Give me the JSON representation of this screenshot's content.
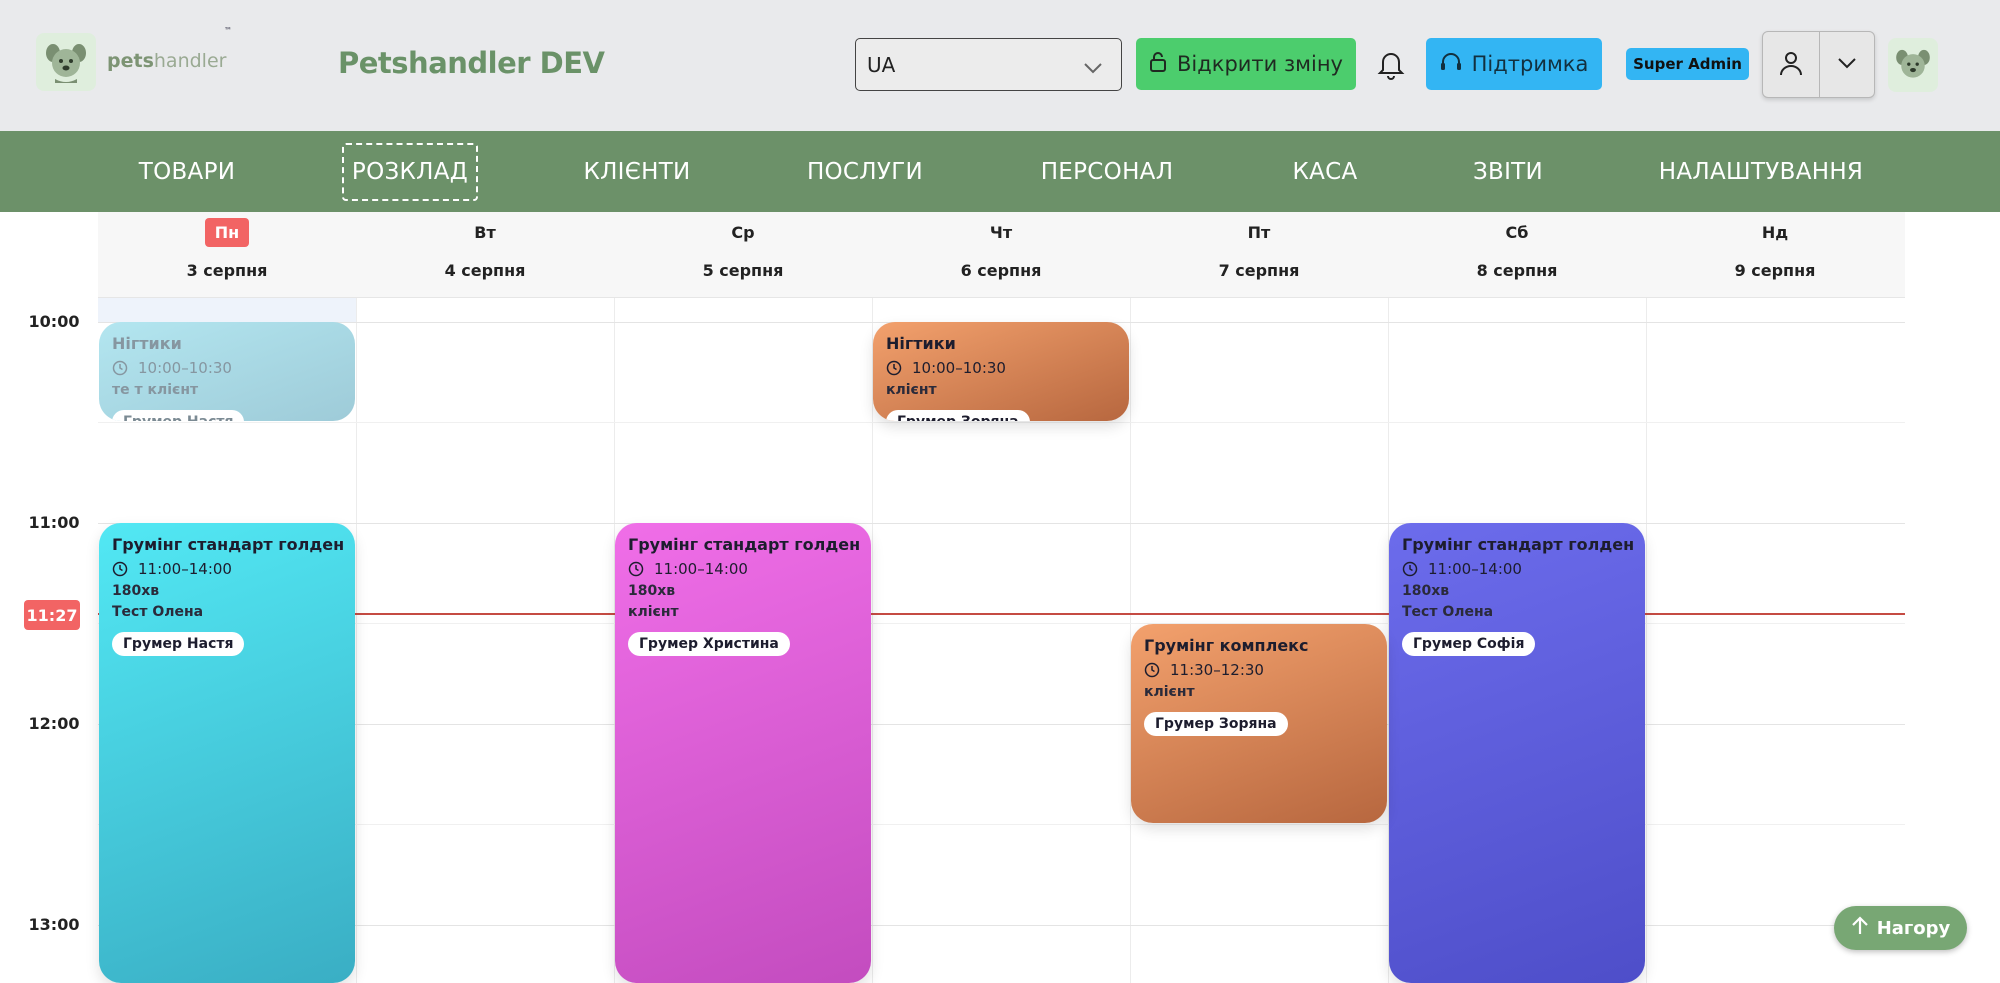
{
  "header": {
    "logo_text_bold": "pets",
    "logo_text_light": "handler",
    "logo_tm": "™",
    "app_title": "Petshandler DEV",
    "language": "UA",
    "open_shift_label": "Відкрити зміну",
    "support_label": "Підтримка",
    "role_badge": "Super Admin"
  },
  "nav": {
    "items": [
      "ТОВАРИ",
      "РОЗКЛАД",
      "КЛІЄНТИ",
      "ПОСЛУГИ",
      "ПЕРСОНАЛ",
      "КАСА",
      "ЗВІТИ",
      "НАЛАШТУВАННЯ"
    ],
    "active": "РОЗКЛАД"
  },
  "calendar": {
    "days": [
      {
        "name": "Пн",
        "date": "3 серпня",
        "today": true
      },
      {
        "name": "Вт",
        "date": "4 серпня",
        "today": false
      },
      {
        "name": "Ср",
        "date": "5 серпня",
        "today": false
      },
      {
        "name": "Чт",
        "date": "6 серпня",
        "today": false
      },
      {
        "name": "Пт",
        "date": "7 серпня",
        "today": false
      },
      {
        "name": "Сб",
        "date": "8 серпня",
        "today": false
      },
      {
        "name": "Нд",
        "date": "9 серпня",
        "today": false
      }
    ],
    "hours": [
      "10:00",
      "11:00",
      "12:00",
      "13:00"
    ],
    "now_label": "11:27",
    "events": [
      {
        "day": 0,
        "start": "10:00",
        "end": "10:30",
        "title": "Нігтики",
        "time": "10:00–10:30",
        "lines": [
          "те т клієнт"
        ],
        "groomer": "Грумер Настя",
        "past": true,
        "gradient": [
          "#b3e6f0",
          "#9ecbd8"
        ]
      },
      {
        "day": 3,
        "start": "10:00",
        "end": "10:30",
        "title": "Нігтики",
        "time": "10:00–10:30",
        "lines": [
          "клієнт"
        ],
        "groomer": "Грумер Зоряна",
        "past": false,
        "gradient": [
          "#f3a16d",
          "#b7673f"
        ]
      },
      {
        "day": 0,
        "start": "11:00",
        "end": "14:00",
        "title": "Грумінг стандарт голден",
        "time": "11:00–14:00",
        "lines": [
          "180хв",
          "Тест Олена"
        ],
        "groomer": "Грумер Настя",
        "past": false,
        "gradient": [
          "#52e8f4",
          "#3aaec4"
        ]
      },
      {
        "day": 2,
        "start": "11:00",
        "end": "14:00",
        "title": "Грумінг стандарт голден",
        "time": "11:00–14:00",
        "lines": [
          "180хв",
          "клієнт"
        ],
        "groomer": "Грумер Христина",
        "past": false,
        "gradient": [
          "#f06ee8",
          "#c34cbf"
        ]
      },
      {
        "day": 5,
        "start": "11:00",
        "end": "14:00",
        "title": "Грумінг стандарт голден",
        "time": "11:00–14:00",
        "lines": [
          "180хв",
          "Тест Олена"
        ],
        "groomer": "Грумер Софія",
        "past": false,
        "gradient": [
          "#6c6cec",
          "#4e4ec9"
        ]
      },
      {
        "day": 4,
        "start": "11:30",
        "end": "12:30",
        "title": "Грумінг комплекс",
        "time": "11:30–12:30",
        "lines": [
          "клієнт"
        ],
        "groomer": "Грумер Зоряна",
        "past": false,
        "gradient": [
          "#f3a16d",
          "#b7673f"
        ]
      }
    ]
  },
  "scroll_top_label": "Нагору",
  "colors": {
    "header_bg": "#e9eaec",
    "nav_bg": "#6c9169",
    "shift_button": "#4ccd6d",
    "support_button": "#33b5f3",
    "today_accent": "#f26464",
    "now_line": "#c54b43"
  },
  "icons": [
    "dog-logo-icon",
    "chevron-down-icon",
    "lock-icon",
    "bell-icon",
    "headset-icon",
    "user-icon",
    "clock-icon",
    "arrow-up-icon"
  ]
}
